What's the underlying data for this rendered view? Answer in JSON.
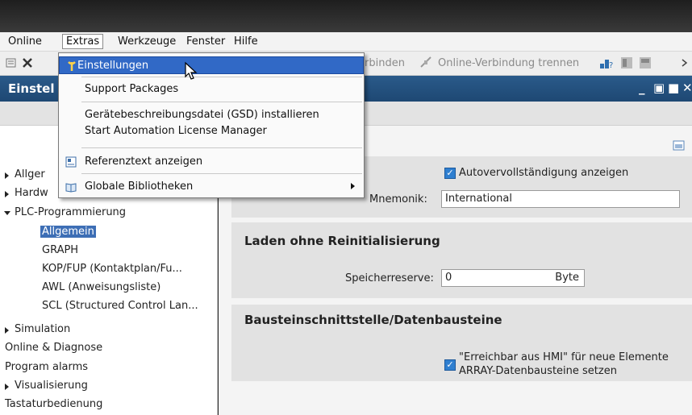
{
  "menubar": {
    "items": [
      "Online",
      "Extras",
      "Werkzeuge",
      "Fenster",
      "Hilfe"
    ]
  },
  "toolbar": {
    "connect_fragment": "rbinden",
    "disconnect_label": "Online-Verbindung trennen"
  },
  "window": {
    "title": "Einstel"
  },
  "extras_menu": {
    "items": [
      {
        "label": "Einstellungen",
        "icon": "wrench-icon"
      },
      {
        "label": "Support Packages"
      },
      {
        "label": "Gerätebeschreibungsdatei (GSD) installieren"
      },
      {
        "label": "Start Automation License Manager"
      },
      {
        "label": "Referenztext anzeigen",
        "icon": "reference-text-icon"
      },
      {
        "label": "Globale Bibliotheken",
        "icon": "library-icon"
      }
    ]
  },
  "tree": {
    "items": [
      {
        "label": "Allger",
        "arrow": "right"
      },
      {
        "label": "Hardw",
        "arrow": "right"
      },
      {
        "label": "PLC-Programmierung",
        "arrow": "down"
      },
      {
        "label": "Allgemein",
        "selected": true
      },
      {
        "label": "GRAPH"
      },
      {
        "label": "KOP/FUP (Kontaktplan/Fu..."
      },
      {
        "label": "AWL (Anweisungsliste)"
      },
      {
        "label": "SCL (Structured Control Lan..."
      },
      {
        "label": "Simulation",
        "arrow": "right"
      },
      {
        "label": "Online & Diagnose"
      },
      {
        "label": "Program alarms"
      },
      {
        "label": "Visualisierung",
        "arrow": "right"
      },
      {
        "label": "Tastaturbedienung"
      }
    ]
  },
  "settings": {
    "autocomplete_label": "Autovervollständigung anzeigen",
    "autocomplete_checked": true,
    "mnemonic_label": "Mnemonik:",
    "mnemonic_value": "International",
    "section_load_title": "Laden ohne Reinitialisierung",
    "memory_reserve_label": "Speicherreserve:",
    "memory_reserve_value": "0",
    "memory_reserve_unit": "Byte",
    "section_interface_title": "Bausteinschnittstelle/Datenbausteine",
    "hmi_line1": "\"Erreichbar aus HMI\" für neue Elemente",
    "hmi_line2": "ARRAY-Datenbausteine setzen",
    "hmi_checked": true
  },
  "colors": {
    "title_bar": "#1e4873",
    "highlight": "#3169c6",
    "checkbox": "#2f7fd0"
  }
}
